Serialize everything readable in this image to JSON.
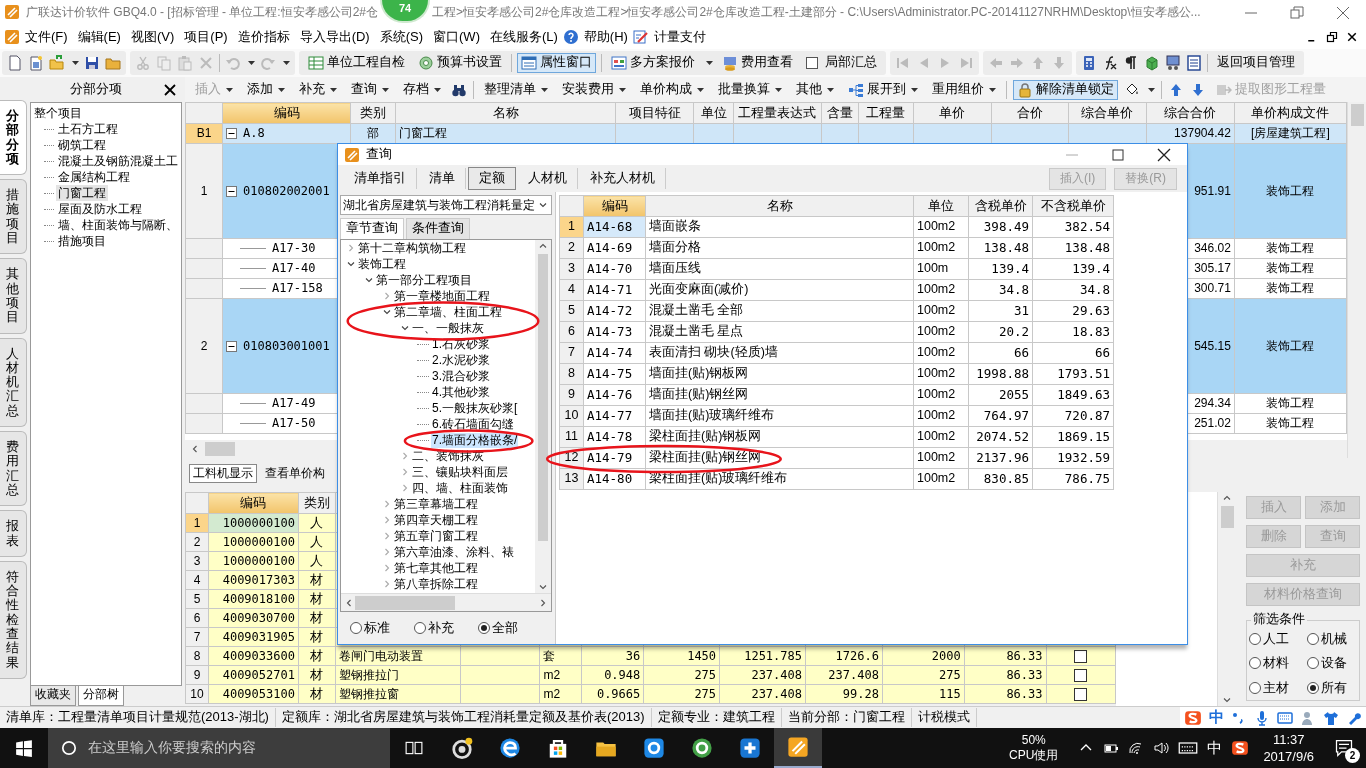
{
  "title_bar": {
    "title_start": "广联达计价软件 GBQ4.0 - [招标管理 - 单位工程:恒安孝感公司2#仓",
    "title_end": "工程>恒安孝感公司2#仓库改造工程>恒安孝感公司2#仓库改造工程-土建部分 - C:\\Users\\Administrator.PC-20141127NRHM\\Desktop\\恒安孝感公..."
  },
  "floating_badge": "74",
  "menu_bar": [
    "文件(F)",
    "编辑(E)",
    "视图(V)",
    "项目(P)",
    "造价指标",
    "导入导出(D)",
    "系统(S)",
    "窗口(W)",
    "在线服务(L)",
    "帮助(H)",
    "计量支付"
  ],
  "toolbar_1": {
    "self_check": "单位工程自检",
    "budget_settings": "预算书设置",
    "property_window": {
      "label": "属性窗口",
      "pressed": true
    },
    "multi_quote": "多方案报价",
    "fee_view": "费用查看",
    "partial_summary": {
      "label": "局部汇总",
      "checked": false
    },
    "back_to_project": "返回项目管理"
  },
  "panel_header": "分部分项",
  "toolbar_2": {
    "group_1": [
      {
        "label": "插入",
        "disabled": true
      },
      {
        "label": "添加",
        "disabled": false
      },
      {
        "label": "补充",
        "disabled": false
      },
      {
        "label": "查询",
        "disabled": false
      },
      {
        "label": "存档",
        "disabled": false
      }
    ],
    "group_2": [
      {
        "label": "整理清单",
        "disabled": false
      },
      {
        "label": "安装费用",
        "disabled": false
      },
      {
        "label": "单价构成",
        "disabled": false
      },
      {
        "label": "批量换算",
        "disabled": false
      },
      {
        "label": "其他",
        "disabled": false
      }
    ],
    "expand_to": "展开到",
    "reuse_pricing": "重用组价",
    "unlock": {
      "label": "解除清单锁定",
      "pressed": true
    },
    "extract": {
      "label": "提取图形工程量",
      "disabled": true
    }
  },
  "side_tabs": [
    {
      "label": "分部分项",
      "selected": true
    },
    {
      "label": "措施项目",
      "selected": false
    },
    {
      "label": "其他项目",
      "selected": false
    },
    {
      "label": "人材机汇总",
      "selected": false
    },
    {
      "label": "费用汇总",
      "selected": false
    },
    {
      "label": "报表",
      "selected": false
    },
    {
      "label": "符合性检查结果",
      "selected": false
    }
  ],
  "section_tree": {
    "root": "整个项目",
    "children": [
      {
        "label": "土石方工程",
        "selected": false
      },
      {
        "label": "砌筑工程",
        "selected": false
      },
      {
        "label": "混凝土及钢筋混凝土工",
        "selected": false
      },
      {
        "label": "金属结构工程",
        "selected": false
      },
      {
        "label": "门窗工程",
        "selected": true
      },
      {
        "label": "屋面及防水工程",
        "selected": false
      },
      {
        "label": "墙、柱面装饰与隔断、",
        "selected": false
      },
      {
        "label": "措施项目",
        "selected": false
      }
    ]
  },
  "tree_tabs": [
    {
      "label": "收藏夹",
      "selected": false
    },
    {
      "label": "分部树",
      "selected": true
    }
  ],
  "bill_grid": {
    "columns": [
      "编码",
      "类别",
      "名称",
      "项目特征",
      "单位",
      "工程量表达式",
      "含量",
      "工程量",
      "单价",
      "合价",
      "综合单价",
      "综合合价",
      "单价构成文件"
    ],
    "rows": [
      {
        "kind": "section",
        "number": "B1",
        "code": "A.8",
        "expanded": true,
        "type": "部",
        "name": "门窗工程",
        "total": "137904.42",
        "fee_file": "[房屋建筑工程]"
      },
      {
        "kind": "item",
        "number": "1",
        "code": "010802002001",
        "expanded": true,
        "total": "951.91",
        "fee_file": "装饰工程"
      },
      {
        "kind": "quota",
        "code": "A17-30",
        "total": "346.02",
        "fee_file": "装饰工程"
      },
      {
        "kind": "quota",
        "code": "A17-40",
        "total": "305.17",
        "fee_file": "装饰工程"
      },
      {
        "kind": "quota",
        "code": "A17-158",
        "total": "300.71",
        "fee_file": "装饰工程"
      },
      {
        "kind": "item",
        "number": "2",
        "code": "010803001001",
        "expanded": true,
        "total": "545.15",
        "fee_file": "装饰工程"
      },
      {
        "kind": "quota",
        "code": "A17-49",
        "total": "294.34",
        "fee_file": "装饰工程"
      },
      {
        "kind": "quota",
        "code": "A17-50",
        "total": "251.02",
        "fee_file": "装饰工程"
      }
    ]
  },
  "lower_tabs": [
    {
      "label": "工料机显示",
      "selected": true
    },
    {
      "label": "查看单价构",
      "selected": false
    }
  ],
  "resource_grid": {
    "columns": [
      "编码",
      "类别"
    ],
    "rows": [
      {
        "number": "1",
        "code": "1000000100",
        "type": "人",
        "selected": true
      },
      {
        "number": "2",
        "code": "1000000100",
        "type": "人",
        "selected": false
      },
      {
        "number": "3",
        "code": "1000000100",
        "type": "人",
        "selected": false
      },
      {
        "number": "4",
        "code": "4009017303",
        "type": "材",
        "selected": false
      },
      {
        "number": "5",
        "code": "4009018100",
        "type": "材",
        "selected": false
      },
      {
        "number": "6",
        "code": "4009030700",
        "type": "材",
        "selected": false
      },
      {
        "number": "7",
        "code": "4009031905",
        "type": "材",
        "selected": false
      },
      {
        "number": "8",
        "code": "4009033600",
        "type": "材",
        "selected": false,
        "name": "卷闸门电动装置",
        "unit": "套",
        "values": [
          "36",
          "1450",
          "1251.785",
          "1726.6",
          "2000",
          "86.33"
        ],
        "checked": false
      },
      {
        "number": "9",
        "code": "4009052701",
        "type": "材",
        "selected": false,
        "name": "塑钢推拉门",
        "unit": "m2",
        "values": [
          "0.948",
          "275",
          "237.408",
          "237.408",
          "275",
          "86.33"
        ],
        "checked": false
      },
      {
        "number": "10",
        "code": "4009053100",
        "type": "材",
        "selected": false,
        "name": "塑钢推拉窗",
        "unit": "m2",
        "values": [
          "0.9665",
          "275",
          "237.408",
          "99.28",
          "115",
          "86.33"
        ],
        "checked": false
      }
    ]
  },
  "side_buttons": [
    {
      "label": "插入",
      "disabled": true
    },
    {
      "label": "添加",
      "disabled": true
    },
    {
      "label": "删除",
      "disabled": true
    },
    {
      "label": "查询",
      "disabled": true
    },
    {
      "label": "补充",
      "disabled": true
    },
    {
      "label": "材料价格查询",
      "disabled": true
    }
  ],
  "filter": {
    "title": "筛选条件",
    "options": [
      {
        "label": "人工",
        "selected": false
      },
      {
        "label": "机械",
        "selected": false
      },
      {
        "label": "材料",
        "selected": false
      },
      {
        "label": "设备",
        "selected": false
      },
      {
        "label": "主材",
        "selected": false
      },
      {
        "label": "所有",
        "selected": true
      }
    ]
  },
  "dialog": {
    "title": "查询",
    "tabs": [
      {
        "label": "清单指引",
        "selected": false
      },
      {
        "label": "清单",
        "selected": false
      },
      {
        "label": "定额",
        "selected": true
      },
      {
        "label": "人材机",
        "selected": false
      },
      {
        "label": "补充人材机",
        "selected": false
      }
    ],
    "buttons": [
      {
        "label": "插入(I)",
        "disabled": true
      },
      {
        "label": "替换(R)",
        "disabled": true
      }
    ],
    "library": "湖北省房屋建筑与装饰工程消耗量定",
    "query_tabs": [
      {
        "label": "章节查询",
        "selected": true
      },
      {
        "label": "条件查询",
        "selected": false
      }
    ],
    "tree": [
      {
        "label": "第十二章构筑物工程",
        "expanded": false,
        "selected": false,
        "circled": false
      },
      {
        "label": "装饰工程",
        "expanded": true,
        "selected": false,
        "circled": false,
        "children": [
          {
            "label": "第一部分工程项目",
            "expanded": true,
            "selected": false,
            "circled": false,
            "children": [
              {
                "label": "第一章楼地面工程",
                "expanded": false,
                "selected": false,
                "circled": false
              },
              {
                "label": "第二章墙、柱面工程",
                "expanded": true,
                "selected": false,
                "circled": true,
                "children": [
                  {
                    "label": "一、一般抹灰",
                    "expanded": true,
                    "selected": false,
                    "circled": false,
                    "children": [
                      {
                        "label": "1.石灰砂浆",
                        "selected": false,
                        "circled": false
                      },
                      {
                        "label": "2.水泥砂浆",
                        "selected": false,
                        "circled": false
                      },
                      {
                        "label": "3.混合砂浆",
                        "selected": false,
                        "circled": false
                      },
                      {
                        "label": "4.其他砂浆",
                        "selected": false,
                        "circled": false
                      },
                      {
                        "label": "5.一般抹灰砂浆[",
                        "selected": false,
                        "circled": false
                      },
                      {
                        "label": "6.砖石墙面勾缝",
                        "selected": false,
                        "circled": false
                      },
                      {
                        "label": "7.墙面分格嵌条/",
                        "selected": true,
                        "circled": true
                      }
                    ]
                  },
                  {
                    "label": "二、装饰抹灰",
                    "expanded": false,
                    "selected": false,
                    "circled": false
                  },
                  {
                    "label": "三、镶贴块料面层",
                    "expanded": false,
                    "selected": false,
                    "circled": false
                  },
                  {
                    "label": "四、墙、柱面装饰",
                    "expanded": false,
                    "selected": false,
                    "circled": false
                  }
                ]
              },
              {
                "label": "第三章幕墙工程",
                "expanded": false,
                "selected": false,
                "circled": false
              },
              {
                "label": "第四章天棚工程",
                "expanded": false,
                "selected": false,
                "circled": false
              },
              {
                "label": "第五章门窗工程",
                "expanded": false,
                "selected": false,
                "circled": false
              },
              {
                "label": "第六章油漆、涂料、裱",
                "expanded": false,
                "selected": false,
                "circled": false
              },
              {
                "label": "第七章其他工程",
                "expanded": false,
                "selected": false,
                "circled": false
              },
              {
                "label": "第八章拆除工程",
                "expanded": false,
                "selected": false,
                "circled": false
              }
            ]
          }
        ]
      }
    ],
    "scope_options": [
      {
        "label": "标准",
        "selected": false
      },
      {
        "label": "补充",
        "selected": false
      },
      {
        "label": "全部",
        "selected": true
      }
    ],
    "quota_table": {
      "columns": [
        "编码",
        "名称",
        "单位",
        "含税单价",
        "不含税单价"
      ],
      "rows": [
        {
          "number": "1",
          "code": "A14-68",
          "name": "墙面嵌条",
          "unit": "100m2",
          "price_tax": "398.49",
          "price_net": "382.54",
          "selected": true,
          "circled": false
        },
        {
          "number": "2",
          "code": "A14-69",
          "name": "墙面分格",
          "unit": "100m2",
          "price_tax": "138.48",
          "price_net": "138.48",
          "selected": false,
          "circled": false
        },
        {
          "number": "3",
          "code": "A14-70",
          "name": "墙面压线",
          "unit": "100m",
          "price_tax": "139.4",
          "price_net": "139.4",
          "selected": false,
          "circled": false
        },
        {
          "number": "4",
          "code": "A14-71",
          "name": "光面变麻面(减价)",
          "unit": "100m2",
          "price_tax": "34.8",
          "price_net": "34.8",
          "selected": false,
          "circled": false
        },
        {
          "number": "5",
          "code": "A14-72",
          "name": "混凝土凿毛 全部",
          "unit": "100m2",
          "price_tax": "31",
          "price_net": "29.63",
          "selected": false,
          "circled": false
        },
        {
          "number": "6",
          "code": "A14-73",
          "name": "混凝土凿毛 星点",
          "unit": "100m2",
          "price_tax": "20.2",
          "price_net": "18.83",
          "selected": false,
          "circled": false
        },
        {
          "number": "7",
          "code": "A14-74",
          "name": "表面清扫 砌块(轻质)墙",
          "unit": "100m2",
          "price_tax": "66",
          "price_net": "66",
          "selected": false,
          "circled": false
        },
        {
          "number": "8",
          "code": "A14-75",
          "name": "墙面挂(贴)钢板网",
          "unit": "100m2",
          "price_tax": "1998.88",
          "price_net": "1793.51",
          "selected": false,
          "circled": false
        },
        {
          "number": "9",
          "code": "A14-76",
          "name": "墙面挂(贴)钢丝网",
          "unit": "100m2",
          "price_tax": "2055",
          "price_net": "1849.63",
          "selected": false,
          "circled": false
        },
        {
          "number": "10",
          "code": "A14-77",
          "name": "墙面挂(贴)玻璃纤维布",
          "unit": "100m2",
          "price_tax": "764.97",
          "price_net": "720.87",
          "selected": false,
          "circled": false
        },
        {
          "number": "11",
          "code": "A14-78",
          "name": "梁柱面挂(贴)钢板网",
          "unit": "100m2",
          "price_tax": "2074.52",
          "price_net": "1869.15",
          "selected": false,
          "circled": false
        },
        {
          "number": "12",
          "code": "A14-79",
          "name": "梁柱面挂(贴)钢丝网",
          "unit": "100m2",
          "price_tax": "2137.96",
          "price_net": "1932.59",
          "selected": false,
          "circled": true
        },
        {
          "number": "13",
          "code": "A14-80",
          "name": "梁柱面挂(贴)玻璃纤维布",
          "unit": "100m2",
          "price_tax": "830.85",
          "price_net": "786.75",
          "selected": false,
          "circled": false
        }
      ]
    }
  },
  "status_bar": [
    "清单库：工程量清单项目计量规范(2013-湖北)",
    "定额库：湖北省房屋建筑与装饰工程消耗量定额及基价表(2013)",
    "定额专业：建筑工程",
    "当前分部：门窗工程",
    "计税模式"
  ],
  "ime_bar": {
    "mode": "中"
  },
  "taskbar": {
    "search_placeholder": "在这里输入你要搜索的内容",
    "cpu_percent": "50%",
    "cpu_label": "CPU使用",
    "ime": "中",
    "time": "11:37",
    "date": "2017/9/6",
    "notifications": "2"
  }
}
